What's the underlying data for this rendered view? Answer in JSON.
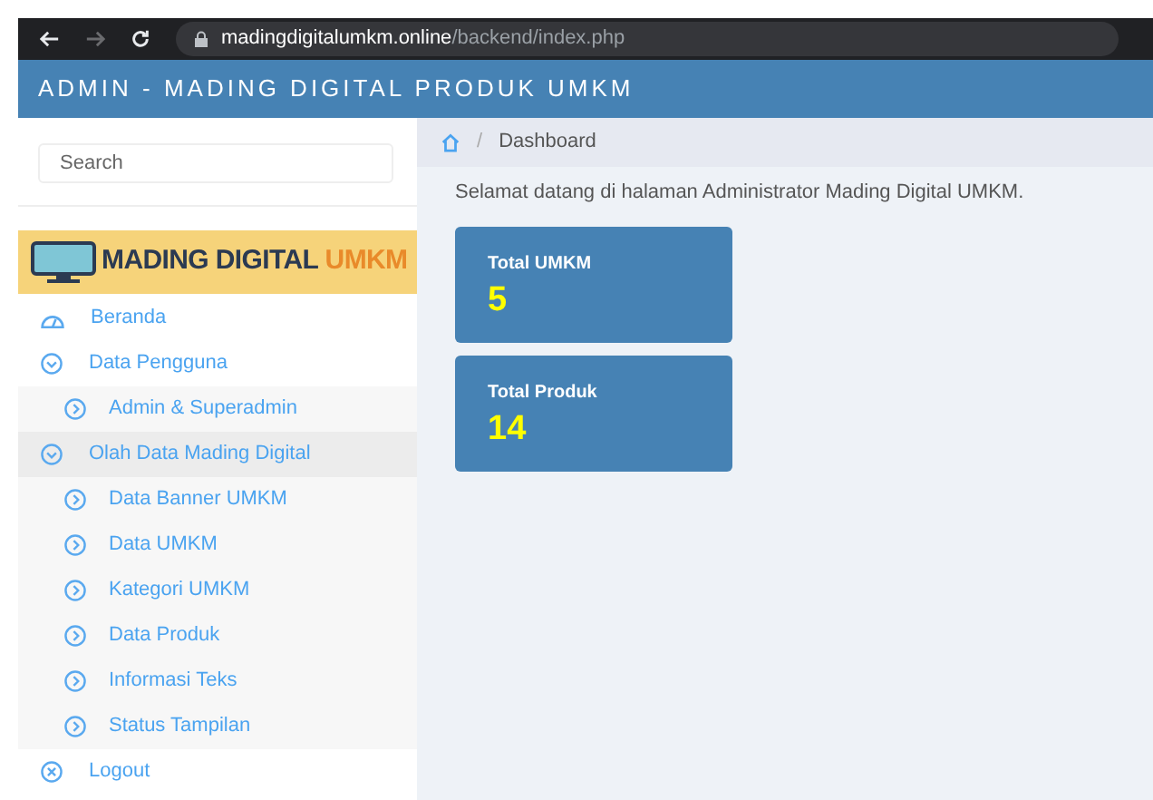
{
  "browser": {
    "url_host": "madingdigitalumkm.online",
    "url_path": "/backend/index.php",
    "forward_disabled": true
  },
  "header": {
    "title": "ADMIN - MADING DIGITAL PRODUK UMKM"
  },
  "sidebar": {
    "search": {
      "placeholder": "Search"
    },
    "logo": {
      "text": "MADING DIGITAL",
      "accent": "UMKM"
    },
    "items": [
      {
        "label": "Beranda",
        "kind": "dashboard",
        "selected": false
      },
      {
        "label": "Data Pengguna",
        "kind": "group",
        "selected": false,
        "expanded": true,
        "children": [
          {
            "label": "Admin & Superadmin"
          }
        ]
      },
      {
        "label": "Olah Data Mading Digital",
        "kind": "group",
        "selected": true,
        "expanded": true,
        "children": [
          {
            "label": "Data Banner UMKM"
          },
          {
            "label": "Data UMKM"
          },
          {
            "label": "Kategori UMKM"
          },
          {
            "label": "Data Produk"
          },
          {
            "label": "Informasi Teks"
          },
          {
            "label": "Status Tampilan"
          }
        ]
      },
      {
        "label": "Logout",
        "kind": "logout",
        "selected": false
      }
    ]
  },
  "breadcrumb": {
    "separator": "/",
    "items": [
      "Dashboard"
    ]
  },
  "welcome": "Selamat datang di halaman Administrator Mading Digital UMKM.",
  "cards": [
    {
      "title": "Total UMKM",
      "value": "5"
    },
    {
      "title": "Total Produk",
      "value": "14"
    }
  ]
}
